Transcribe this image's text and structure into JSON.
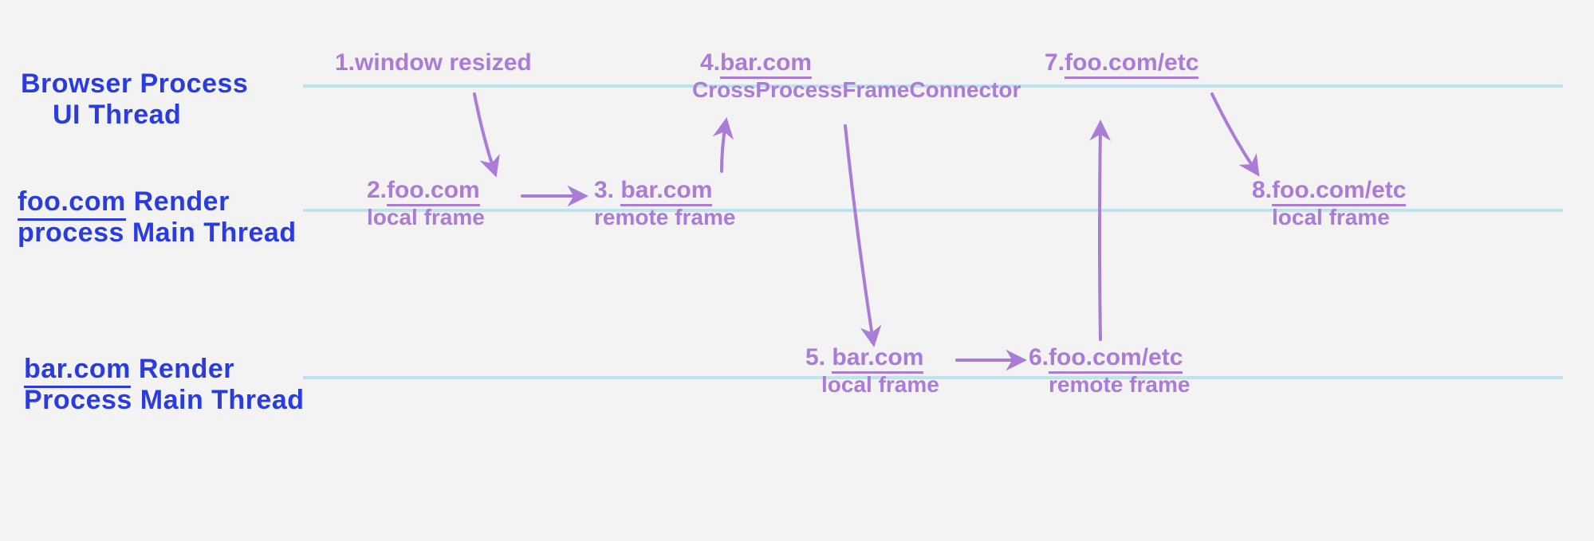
{
  "colors": {
    "lane_label": "#2a3be0",
    "lane_line": "#bde3ee",
    "step": "#aa7bd7",
    "background": "#f3f3f3"
  },
  "lanes": [
    {
      "id": "browser-ui",
      "label_line1": "Browser Process",
      "label_line2": "UI Thread",
      "underline_domain": ""
    },
    {
      "id": "foo-render",
      "label_line1_prefix": "",
      "label_line1_domain": "foo.com",
      "label_line1_suffix": " Render",
      "label_line2": "process Main Thread"
    },
    {
      "id": "bar-render",
      "label_line1_prefix": "",
      "label_line1_domain": "bar.com",
      "label_line1_suffix": " Render",
      "label_line2": "Process Main Thread"
    }
  ],
  "steps": {
    "s1": {
      "num": "1.",
      "title": "window resized"
    },
    "s2": {
      "num": "2.",
      "domain": "foo.com",
      "sub": "local frame"
    },
    "s3": {
      "num": "3.",
      "domain": "bar.com",
      "sub": "remote frame"
    },
    "s4": {
      "num": "4.",
      "domain": "bar.com",
      "sub": "CrossProcessFrameConnector"
    },
    "s5": {
      "num": "5.",
      "domain": "bar.com",
      "sub": "local frame"
    },
    "s6": {
      "num": "6.",
      "domain": "foo.com/etc",
      "sub": "remote frame"
    },
    "s7": {
      "num": "7.",
      "domain": "foo.com/etc"
    },
    "s8": {
      "num": "8.",
      "domain": "foo.com/etc",
      "sub": "local frame"
    }
  },
  "arrows": [
    {
      "from": 1,
      "to": 2
    },
    {
      "from": 2,
      "to": 3
    },
    {
      "from": 3,
      "to": 4
    },
    {
      "from": 4,
      "to": 5
    },
    {
      "from": 5,
      "to": 6
    },
    {
      "from": 6,
      "to": 7
    },
    {
      "from": 7,
      "to": 8
    }
  ]
}
